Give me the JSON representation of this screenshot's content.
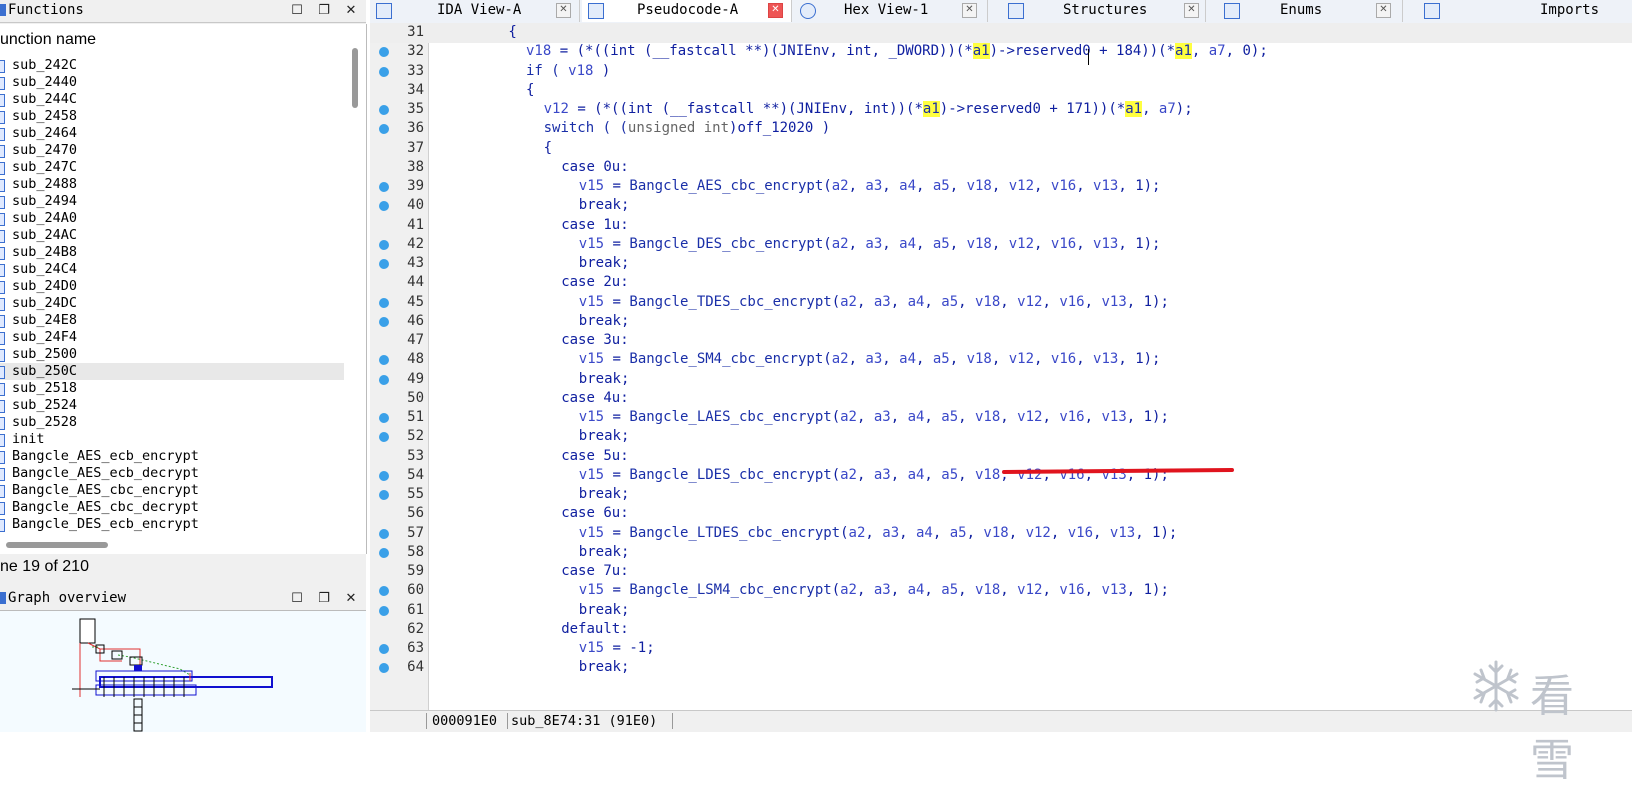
{
  "functions_panel": {
    "title": "Functions",
    "column_header": "unction name",
    "items": [
      "sub_242C",
      "sub_2440",
      "sub_244C",
      "sub_2458",
      "sub_2464",
      "sub_2470",
      "sub_247C",
      "sub_2488",
      "sub_2494",
      "sub_24A0",
      "sub_24AC",
      "sub_24B8",
      "sub_24C4",
      "sub_24D0",
      "sub_24DC",
      "sub_24E8",
      "sub_24F4",
      "sub_2500",
      "sub_250C",
      "sub_2518",
      "sub_2524",
      "sub_2528",
      "init",
      "Bangcle_AES_ecb_encrypt",
      "Bangcle_AES_ecb_decrypt",
      "Bangcle_AES_cbc_encrypt",
      "Bangcle_AES_cbc_decrypt",
      "Bangcle_DES_ecb_encrypt"
    ],
    "selected_index": 18,
    "status": "ne 19 of 210"
  },
  "graph_panel": {
    "title": "Graph overview"
  },
  "tabs": [
    {
      "label": "IDA View-A",
      "icon": "ida-view-icon"
    },
    {
      "label": "Pseudocode-A",
      "icon": "pseudocode-icon",
      "active": true
    },
    {
      "label": "Hex View-1",
      "icon": "hex-view-icon"
    },
    {
      "label": "Structures",
      "icon": "structures-icon"
    },
    {
      "label": "Enums",
      "icon": "enums-icon"
    },
    {
      "label": "Imports",
      "icon": "imports-icon"
    }
  ],
  "code_lines": [
    {
      "n": "31",
      "bp": false
    },
    {
      "n": "32",
      "bp": true
    },
    {
      "n": "33",
      "bp": true
    },
    {
      "n": "34",
      "bp": false
    },
    {
      "n": "35",
      "bp": true
    },
    {
      "n": "36",
      "bp": true
    },
    {
      "n": "37",
      "bp": false
    },
    {
      "n": "38",
      "bp": false
    },
    {
      "n": "39",
      "bp": true
    },
    {
      "n": "40",
      "bp": true
    },
    {
      "n": "41",
      "bp": false
    },
    {
      "n": "42",
      "bp": true
    },
    {
      "n": "43",
      "bp": true
    },
    {
      "n": "44",
      "bp": false
    },
    {
      "n": "45",
      "bp": true
    },
    {
      "n": "46",
      "bp": true
    },
    {
      "n": "47",
      "bp": false
    },
    {
      "n": "48",
      "bp": true
    },
    {
      "n": "49",
      "bp": true
    },
    {
      "n": "50",
      "bp": false
    },
    {
      "n": "51",
      "bp": true
    },
    {
      "n": "52",
      "bp": true
    },
    {
      "n": "53",
      "bp": false
    },
    {
      "n": "54",
      "bp": true
    },
    {
      "n": "55",
      "bp": true
    },
    {
      "n": "56",
      "bp": false
    },
    {
      "n": "57",
      "bp": true
    },
    {
      "n": "58",
      "bp": true
    },
    {
      "n": "59",
      "bp": false
    },
    {
      "n": "60",
      "bp": true
    },
    {
      "n": "61",
      "bp": true
    },
    {
      "n": "62",
      "bp": false
    },
    {
      "n": "63",
      "bp": true
    },
    {
      "n": "64",
      "bp": true
    }
  ],
  "code": {
    "l31": "{",
    "l32a": "v18",
    "l32b": " = (*((int (__fastcall **)(JNIEnv, int, _DWORD))(*",
    "l32c": "a1",
    "l32d": ")->reserved0 + 184))(*",
    "l32e": "a1",
    "l32f": ", ",
    "l32g": "a7",
    "l32h": ", 0);",
    "l33a": "if ( ",
    "l33b": "v18",
    "l33c": " )",
    "l34": "{",
    "l35a": "v12",
    "l35b": " = (*((int (__fastcall **)(JNIEnv, int))(*",
    "l35c": "a1",
    "l35d": ")->reserved0 + 171))(*",
    "l35e": "a1",
    "l35f": ", ",
    "l35g": "a7",
    "l35h": ");",
    "l36a": "switch ( (",
    "l36b": "unsigned int",
    "l36c": ")off_12020 )",
    "l37": "{",
    "l38": "case 0u:",
    "l39f": "Bangcle_AES_cbc_encrypt",
    "l40": "break;",
    "l41": "case 1u:",
    "l42f": "Bangcle_DES_cbc_encrypt",
    "l43": "break;",
    "l44": "case 2u:",
    "l45f": "Bangcle_TDES_cbc_encrypt",
    "l46": "break;",
    "l47": "case 3u:",
    "l48f": "Bangcle_SM4_cbc_encrypt",
    "l49": "break;",
    "l50": "case 4u:",
    "l51f": "Bangcle_LAES_cbc_encrypt",
    "l52": "break;",
    "l53": "case 5u:",
    "l54f": "Bangcle_LDES_cbc_encrypt",
    "l55": "break;",
    "l56": "case 6u:",
    "l57f": "Bangcle_LTDES_cbc_encrypt",
    "l58": "break;",
    "l59": "case 7u:",
    "l60f": "Bangcle_LSM4_cbc_encrypt",
    "l61": "break;",
    "l62": "default:",
    "l63a": "v15",
    "l63b": " = -1;",
    "l64": "break;",
    "v15": "v15",
    "eq": " = ",
    "call_args_a": "(",
    "a2": "a2",
    "a3": "a3",
    "a4": "a4",
    "a5": "a5",
    "v18": "v18",
    "v12": "v12",
    "v16": "v16",
    "v13": "v13",
    "comma": ", ",
    "call_end": ", 1);"
  },
  "status_bar": {
    "address": "000091E0",
    "function": "sub_8E74:31 (91E0)"
  },
  "watermark": {
    "text": "看雪"
  },
  "colors": {
    "accent": "#3b6fd0",
    "highlight": "#ffff40",
    "annotation_red": "#e0141e"
  }
}
